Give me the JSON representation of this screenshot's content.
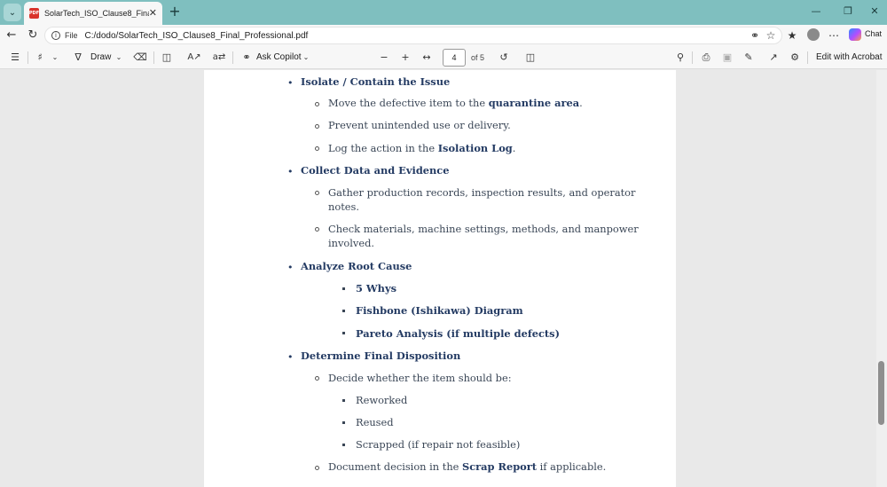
{
  "browser": {
    "tab_title": "SolarTech_ISO_Clause8_Final_Professional.pdf",
    "file_label": "File",
    "url": "C:/dodo/SolarTech_ISO_Clause8_Final_Professional.pdf",
    "chat_label": "Chat"
  },
  "toolbar": {
    "draw_label": "Draw",
    "ask_copilot_label": "Ask Copilot",
    "page_number": "4",
    "page_of": "of 5",
    "edit_acrobat_label": "Edit with Acrobat"
  },
  "document": {
    "s1_heading": "Isolate / Contain the Issue",
    "s1_i1_pre": "Move the defective item to the ",
    "s1_i1_bold": "quarantine area",
    "s1_i1_post": ".",
    "s1_i2": "Prevent unintended use or delivery.",
    "s1_i3_pre": "Log the action in the ",
    "s1_i3_bold": "Isolation Log",
    "s1_i3_post": ".",
    "s2_heading": "Collect Data and Evidence",
    "s2_i1_l1": "Gather production records, inspection results, and operator",
    "s2_i1_l2": "notes.",
    "s2_i2_l1": "Check materials, machine settings, methods, and manpower",
    "s2_i2_l2": "involved.",
    "s3_heading": "Analyze Root Cause",
    "s3_i1": "5 Whys",
    "s3_i2": "Fishbone (Ishikawa) Diagram",
    "s3_i3": "Pareto Analysis (if multiple defects)",
    "s4_heading": "Determine Final Disposition",
    "s4_i1": "Decide whether the item should be:",
    "s4_o1": "Reworked",
    "s4_o2": "Reused",
    "s4_o3": "Scrapped (if repair not feasible)",
    "s4_i2_pre": "Document decision in the ",
    "s4_i2_bold": "Scrap Report",
    "s4_i2_post": " if applicable."
  }
}
